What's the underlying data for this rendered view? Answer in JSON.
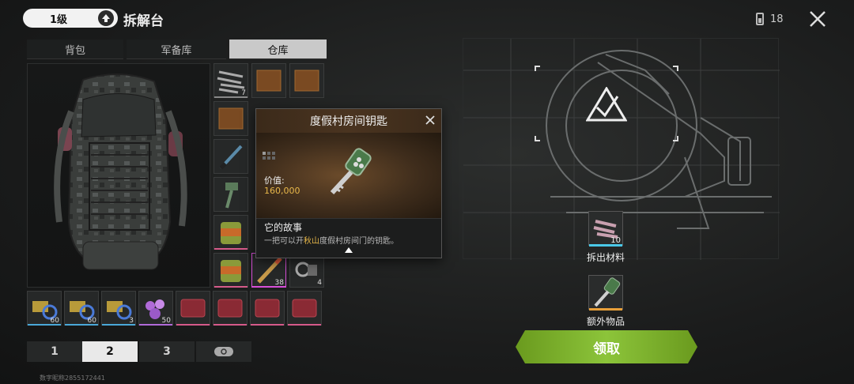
{
  "header": {
    "level_label": "1级",
    "title": "拆解台",
    "battery_count": "18"
  },
  "tabs": [
    {
      "label": "背包",
      "active": false
    },
    {
      "label": "军备库",
      "active": false
    },
    {
      "label": "仓库",
      "active": true
    }
  ],
  "inventory": {
    "grid_items": [
      {
        "name": "metal-scraps",
        "count": "7",
        "bar": "#888888"
      },
      {
        "name": "leather-block",
        "count": "",
        "bar": ""
      },
      {
        "name": "leather-block",
        "count": "",
        "bar": ""
      },
      {
        "name": "leather-block",
        "count": "",
        "bar": ""
      },
      {
        "name": "knife",
        "count": "",
        "bar": ""
      },
      {
        "name": "hammer",
        "count": "",
        "bar": ""
      },
      {
        "name": "canned-food",
        "count": "",
        "bar": "#d65a8a"
      },
      {
        "name": "canned-food",
        "count": "",
        "bar": "#d65a8a"
      },
      {
        "name": "bullet",
        "count": "38",
        "bar": "#d84fd8"
      },
      {
        "name": "parts",
        "count": "4",
        "bar": ""
      }
    ],
    "bottom_items": [
      {
        "name": "gold-wire",
        "count": "60",
        "bar": "#4aa8d8"
      },
      {
        "name": "gold-wire",
        "count": "60",
        "bar": "#4aa8d8"
      },
      {
        "name": "gold-wire",
        "count": "3",
        "bar": "#4aa8d8"
      },
      {
        "name": "gems",
        "count": "50",
        "bar": "#b06ad8"
      },
      {
        "name": "red-crate",
        "count": "",
        "bar": "#d65a8a"
      },
      {
        "name": "red-crate",
        "count": "",
        "bar": "#d65a8a"
      },
      {
        "name": "red-crate",
        "count": "",
        "bar": "#d65a8a"
      },
      {
        "name": "red-crate",
        "count": "",
        "bar": "#d65a8a"
      }
    ],
    "pages": [
      {
        "label": "1",
        "active": false
      },
      {
        "label": "2",
        "active": true
      },
      {
        "label": "3",
        "active": false
      }
    ],
    "footer_id": "数字昵称2855172441"
  },
  "popup": {
    "title": "度假村房间钥匙",
    "value_label": "价值:",
    "value": "160,000",
    "story_title": "它的故事",
    "story_prefix": "一把可以开",
    "story_highlight": "秋山",
    "story_suffix": "度假村房间门的钥匙。"
  },
  "disassembly": {
    "material_count": "10",
    "material_label": "拆出材料",
    "extra_label": "额外物品",
    "claim_label": "领取"
  },
  "colors": {
    "accent_green": "#9ccc3a",
    "highlight_gold": "#e8b84a"
  }
}
